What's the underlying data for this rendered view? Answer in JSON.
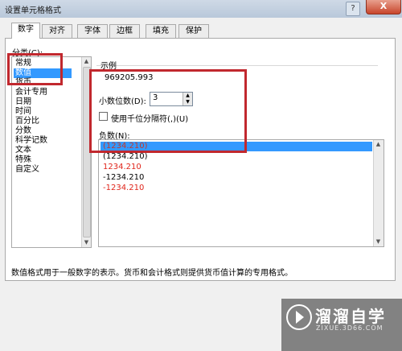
{
  "window": {
    "title": "设置单元格格式",
    "help_label": "?",
    "close_label": "X"
  },
  "tabs": [
    {
      "label": "数字",
      "active": true
    },
    {
      "label": "对齐",
      "active": false
    },
    {
      "label": "字体",
      "active": false
    },
    {
      "label": "边框",
      "active": false
    },
    {
      "label": "填充",
      "active": false
    },
    {
      "label": "保护",
      "active": false
    }
  ],
  "category": {
    "label": "分类(C):",
    "items": [
      "常规",
      "数值",
      "货币",
      "会计专用",
      "日期",
      "时间",
      "百分比",
      "分数",
      "科学记数",
      "文本",
      "特殊",
      "自定义"
    ],
    "selected": "数值"
  },
  "sample": {
    "label": "示例",
    "value": "969205.993"
  },
  "decimals": {
    "label": "小数位数(D):",
    "value": "3"
  },
  "thousands": {
    "label": "使用千位分隔符(,)(U)",
    "checked": false
  },
  "negative": {
    "label": "负数(N):",
    "items": [
      {
        "text": "(1234.210)",
        "color": "#c0392b",
        "selected": true
      },
      {
        "text": "(1234.210)",
        "color": "#000000",
        "selected": false
      },
      {
        "text": "1234.210",
        "color": "#e0251b",
        "selected": false
      },
      {
        "text": "-1234.210",
        "color": "#000000",
        "selected": false
      },
      {
        "text": "-1234.210",
        "color": "#e0251b",
        "selected": false
      }
    ]
  },
  "description": "数值格式用于一般数字的表示。货币和会计格式则提供货币值计算的专用格式。",
  "watermark": {
    "title": "溜溜自学",
    "url": "ZIXUE.3D66.COM"
  },
  "colors": {
    "selection": "#3399ff",
    "highlight_box": "#c1282e",
    "negative_red": "#e0251b"
  }
}
